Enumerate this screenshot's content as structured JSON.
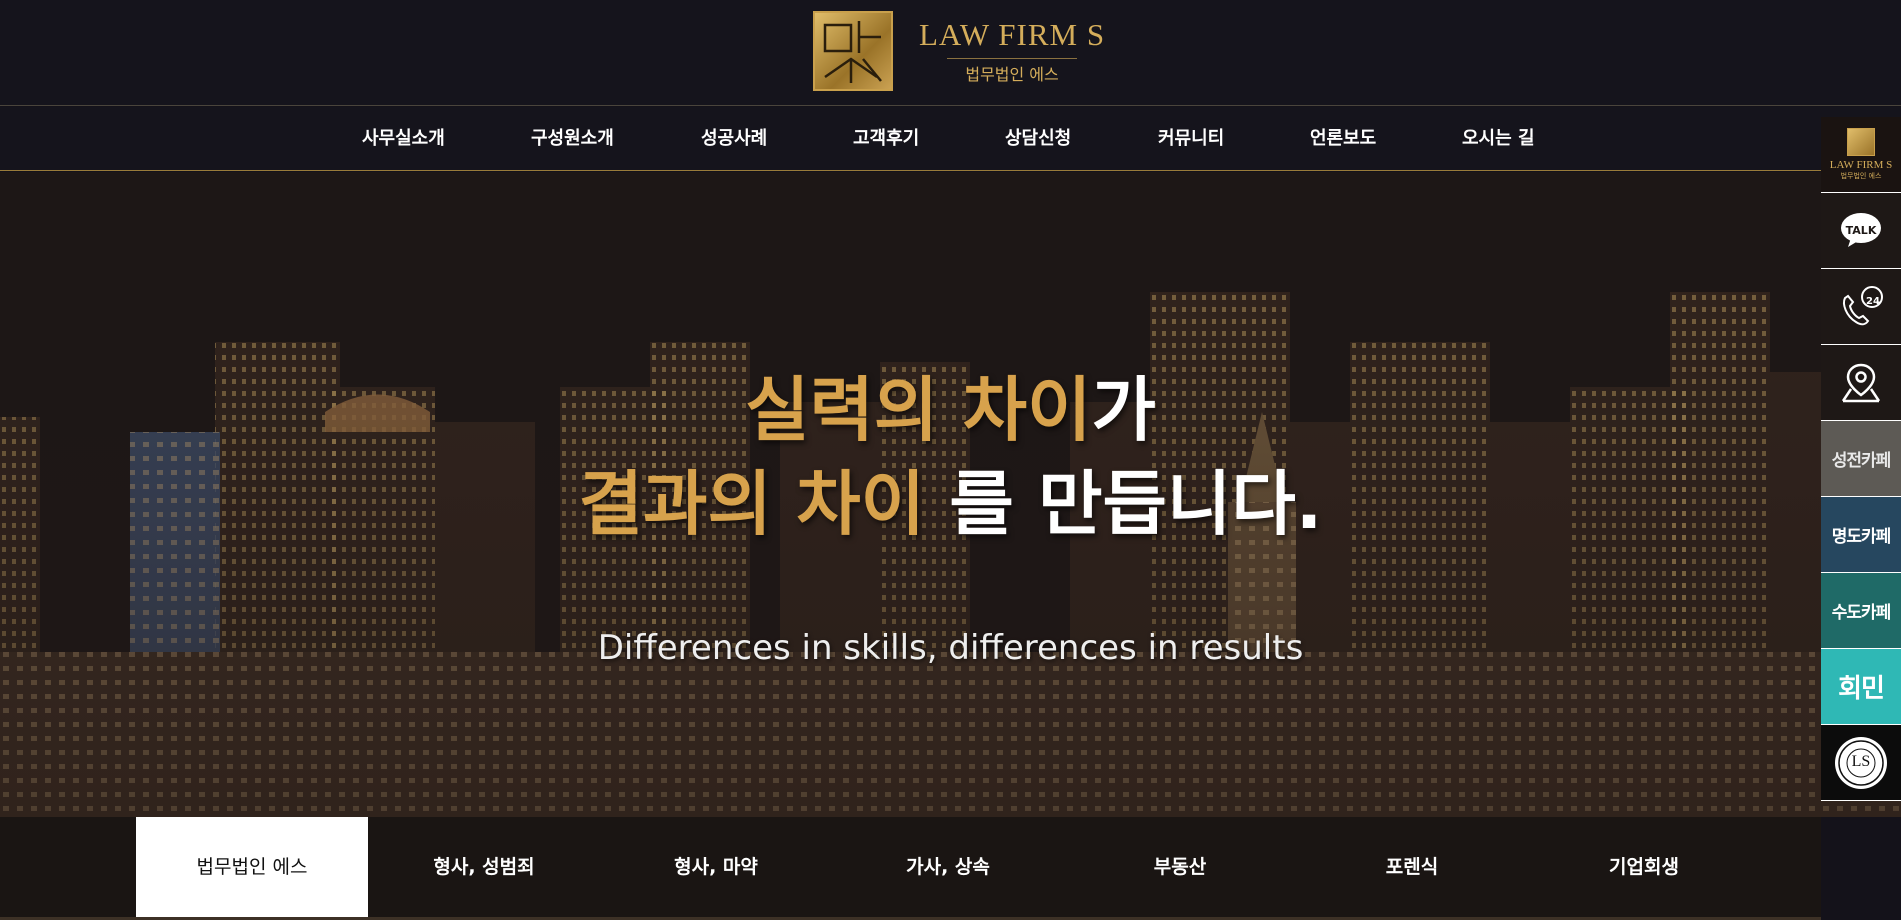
{
  "header": {
    "logo_text_en": "LAW FIRM S",
    "logo_text_ko": "법무법인 에스"
  },
  "nav": {
    "items": [
      "사무실소개",
      "구성원소개",
      "성공사례",
      "고객후기",
      "상담신청",
      "커뮤니티",
      "언론보도",
      "오시는 길"
    ]
  },
  "hero": {
    "line1_gold": "실력의 차이",
    "line1_white": "가",
    "line2_gold": "결과의 차이",
    "line2_white": " 를 만듭니다.",
    "subtitle": "Differences in skills, differences in results"
  },
  "tabs": {
    "items": [
      "법무법인 에스",
      "형사, 성범죄",
      "형사, 마약",
      "가사, 상속",
      "부동산",
      "포렌식",
      "기업회생"
    ],
    "active_index": 0
  },
  "quick": {
    "logo_en": "LAW FIRM S",
    "logo_ko": "법무법인 에스",
    "talk_label": "TALK",
    "call_badge": "24",
    "cafe1": "성전카페",
    "cafe2": "명도카페",
    "cafe3": "수도카페",
    "cafe4": "회민",
    "ls_mark": "LS"
  },
  "colors": {
    "gold": "#d7a24c",
    "background": "#15141c",
    "nav_border": "#9a7c3a"
  }
}
